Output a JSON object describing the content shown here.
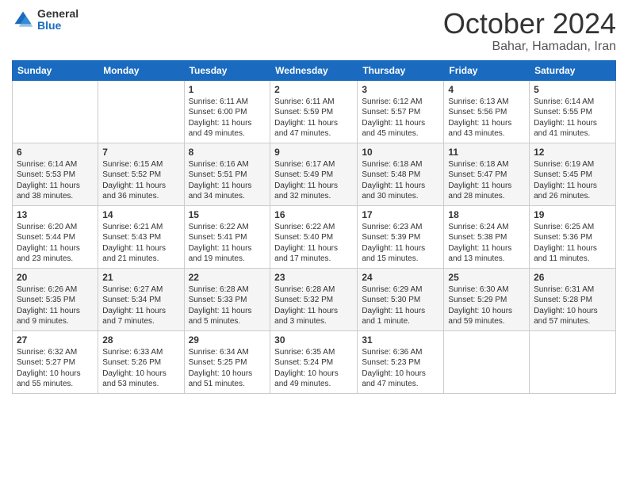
{
  "header": {
    "logo_general": "General",
    "logo_blue": "Blue",
    "month": "October 2024",
    "location": "Bahar, Hamadan, Iran"
  },
  "days_of_week": [
    "Sunday",
    "Monday",
    "Tuesday",
    "Wednesday",
    "Thursday",
    "Friday",
    "Saturday"
  ],
  "weeks": [
    [
      {
        "day": "",
        "content": ""
      },
      {
        "day": "",
        "content": ""
      },
      {
        "day": "1",
        "content": "Sunrise: 6:11 AM\nSunset: 6:00 PM\nDaylight: 11 hours and 49 minutes."
      },
      {
        "day": "2",
        "content": "Sunrise: 6:11 AM\nSunset: 5:59 PM\nDaylight: 11 hours and 47 minutes."
      },
      {
        "day": "3",
        "content": "Sunrise: 6:12 AM\nSunset: 5:57 PM\nDaylight: 11 hours and 45 minutes."
      },
      {
        "day": "4",
        "content": "Sunrise: 6:13 AM\nSunset: 5:56 PM\nDaylight: 11 hours and 43 minutes."
      },
      {
        "day": "5",
        "content": "Sunrise: 6:14 AM\nSunset: 5:55 PM\nDaylight: 11 hours and 41 minutes."
      }
    ],
    [
      {
        "day": "6",
        "content": "Sunrise: 6:14 AM\nSunset: 5:53 PM\nDaylight: 11 hours and 38 minutes."
      },
      {
        "day": "7",
        "content": "Sunrise: 6:15 AM\nSunset: 5:52 PM\nDaylight: 11 hours and 36 minutes."
      },
      {
        "day": "8",
        "content": "Sunrise: 6:16 AM\nSunset: 5:51 PM\nDaylight: 11 hours and 34 minutes."
      },
      {
        "day": "9",
        "content": "Sunrise: 6:17 AM\nSunset: 5:49 PM\nDaylight: 11 hours and 32 minutes."
      },
      {
        "day": "10",
        "content": "Sunrise: 6:18 AM\nSunset: 5:48 PM\nDaylight: 11 hours and 30 minutes."
      },
      {
        "day": "11",
        "content": "Sunrise: 6:18 AM\nSunset: 5:47 PM\nDaylight: 11 hours and 28 minutes."
      },
      {
        "day": "12",
        "content": "Sunrise: 6:19 AM\nSunset: 5:45 PM\nDaylight: 11 hours and 26 minutes."
      }
    ],
    [
      {
        "day": "13",
        "content": "Sunrise: 6:20 AM\nSunset: 5:44 PM\nDaylight: 11 hours and 23 minutes."
      },
      {
        "day": "14",
        "content": "Sunrise: 6:21 AM\nSunset: 5:43 PM\nDaylight: 11 hours and 21 minutes."
      },
      {
        "day": "15",
        "content": "Sunrise: 6:22 AM\nSunset: 5:41 PM\nDaylight: 11 hours and 19 minutes."
      },
      {
        "day": "16",
        "content": "Sunrise: 6:22 AM\nSunset: 5:40 PM\nDaylight: 11 hours and 17 minutes."
      },
      {
        "day": "17",
        "content": "Sunrise: 6:23 AM\nSunset: 5:39 PM\nDaylight: 11 hours and 15 minutes."
      },
      {
        "day": "18",
        "content": "Sunrise: 6:24 AM\nSunset: 5:38 PM\nDaylight: 11 hours and 13 minutes."
      },
      {
        "day": "19",
        "content": "Sunrise: 6:25 AM\nSunset: 5:36 PM\nDaylight: 11 hours and 11 minutes."
      }
    ],
    [
      {
        "day": "20",
        "content": "Sunrise: 6:26 AM\nSunset: 5:35 PM\nDaylight: 11 hours and 9 minutes."
      },
      {
        "day": "21",
        "content": "Sunrise: 6:27 AM\nSunset: 5:34 PM\nDaylight: 11 hours and 7 minutes."
      },
      {
        "day": "22",
        "content": "Sunrise: 6:28 AM\nSunset: 5:33 PM\nDaylight: 11 hours and 5 minutes."
      },
      {
        "day": "23",
        "content": "Sunrise: 6:28 AM\nSunset: 5:32 PM\nDaylight: 11 hours and 3 minutes."
      },
      {
        "day": "24",
        "content": "Sunrise: 6:29 AM\nSunset: 5:30 PM\nDaylight: 11 hours and 1 minute."
      },
      {
        "day": "25",
        "content": "Sunrise: 6:30 AM\nSunset: 5:29 PM\nDaylight: 10 hours and 59 minutes."
      },
      {
        "day": "26",
        "content": "Sunrise: 6:31 AM\nSunset: 5:28 PM\nDaylight: 10 hours and 57 minutes."
      }
    ],
    [
      {
        "day": "27",
        "content": "Sunrise: 6:32 AM\nSunset: 5:27 PM\nDaylight: 10 hours and 55 minutes."
      },
      {
        "day": "28",
        "content": "Sunrise: 6:33 AM\nSunset: 5:26 PM\nDaylight: 10 hours and 53 minutes."
      },
      {
        "day": "29",
        "content": "Sunrise: 6:34 AM\nSunset: 5:25 PM\nDaylight: 10 hours and 51 minutes."
      },
      {
        "day": "30",
        "content": "Sunrise: 6:35 AM\nSunset: 5:24 PM\nDaylight: 10 hours and 49 minutes."
      },
      {
        "day": "31",
        "content": "Sunrise: 6:36 AM\nSunset: 5:23 PM\nDaylight: 10 hours and 47 minutes."
      },
      {
        "day": "",
        "content": ""
      },
      {
        "day": "",
        "content": ""
      }
    ]
  ]
}
